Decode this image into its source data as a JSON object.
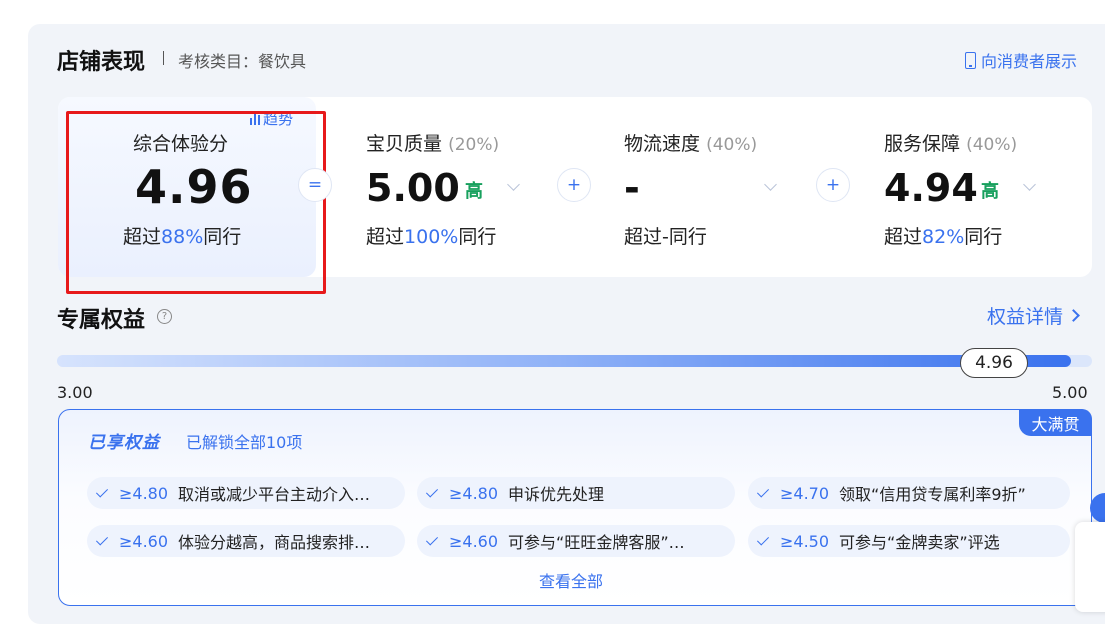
{
  "header": {
    "title": "店铺表现",
    "category": "考核类目：餐饮具",
    "show_to_consumer": "向消费者展示"
  },
  "overall": {
    "trend_label": "趋势",
    "label": "综合体验分",
    "score": "4.96",
    "beat_prefix": "超过",
    "beat_pct": "88%",
    "beat_suffix": "同行"
  },
  "operators": {
    "equals": "=",
    "plus": "+"
  },
  "metrics": [
    {
      "label": "宝贝质量",
      "weight": "(20%)",
      "score": "5.00",
      "level": "高",
      "beat_prefix": "超过",
      "beat_pct": "100%",
      "beat_suffix": "同行"
    },
    {
      "label": "物流速度",
      "weight": "(40%)",
      "score": "-",
      "level": "",
      "beat_prefix": "超过",
      "beat_pct": "-",
      "beat_suffix": "同行"
    },
    {
      "label": "服务保障",
      "weight": "(40%)",
      "score": "4.94",
      "level": "高",
      "beat_prefix": "超过",
      "beat_pct": "82%",
      "beat_suffix": "同行"
    }
  ],
  "benefits_section": {
    "title": "专属权益",
    "help": "?",
    "detail_link": "权益详情",
    "progress": {
      "min": "3.00",
      "max": "5.00",
      "value": 4.96,
      "value_label": "4.96"
    },
    "badge": "大满贯",
    "enjoyed_title": "已享权益",
    "enjoyed_sub": "已解锁全部10项",
    "items": [
      {
        "threshold": "≥4.80",
        "text": "取消或减少平台主动介入…"
      },
      {
        "threshold": "≥4.80",
        "text": "申诉优先处理"
      },
      {
        "threshold": "≥4.70",
        "text": "领取“信用贷专属利率9折”"
      },
      {
        "threshold": "≥4.60",
        "text": "体验分越高，商品搜索排…"
      },
      {
        "threshold": "≥4.60",
        "text": "可参与“旺旺金牌客服”…"
      },
      {
        "threshold": "≥4.50",
        "text": "可参与“金牌卖家”评选"
      }
    ],
    "view_all": "查看全部"
  },
  "colors": {
    "accent": "#3a72ee",
    "level_high": "#17a05d",
    "highlight_box": "#e7191b"
  }
}
